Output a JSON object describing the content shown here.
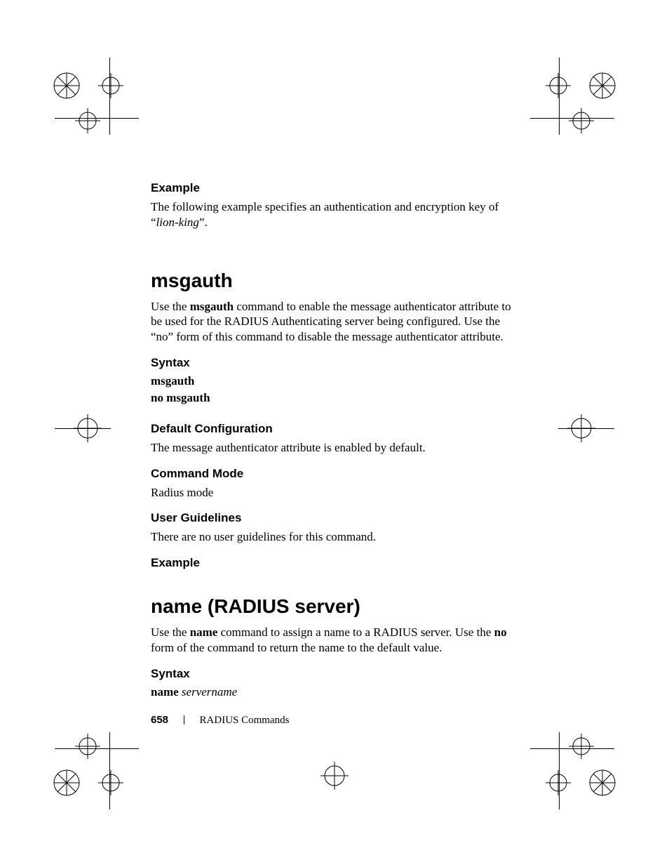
{
  "footer": {
    "page_number": "658",
    "chapter": "RADIUS Commands"
  },
  "section1": {
    "heading": "Example",
    "para_a": "The following example specifies an authentication and encryption key of ",
    "quote_open": "“",
    "quote_term": "lion-king",
    "quote_close": "”."
  },
  "section2": {
    "title": "msgauth",
    "intro_a": "Use the ",
    "intro_bold": "msgauth",
    "intro_b": " command to enable the message authenticator attribute to be used for the RADIUS Authenticating server being configured. Use the “no” form of this command to disable the message authenticator attribute.",
    "syntax_heading": "Syntax",
    "syntax_line1": "msgauth",
    "syntax_line2": "no msgauth",
    "defcfg_heading": "Default Configuration",
    "defcfg_body": "The message authenticator attribute is enabled by default.",
    "cmdmode_heading": "Command Mode",
    "cmdmode_body": "Radius mode",
    "ug_heading": "User Guidelines",
    "ug_body": "There are no user guidelines for this command.",
    "example_heading": "Example"
  },
  "section3": {
    "title": "name (RADIUS server)",
    "intro_a": "Use the ",
    "intro_bold1": "name",
    "intro_b": " command to assign a name to a RADIUS server. Use the ",
    "intro_bold2": "no",
    "intro_c": " form of the command to return the name to the default value.",
    "syntax_heading": "Syntax",
    "syntax_bold": "name",
    "syntax_italic": "servername"
  }
}
